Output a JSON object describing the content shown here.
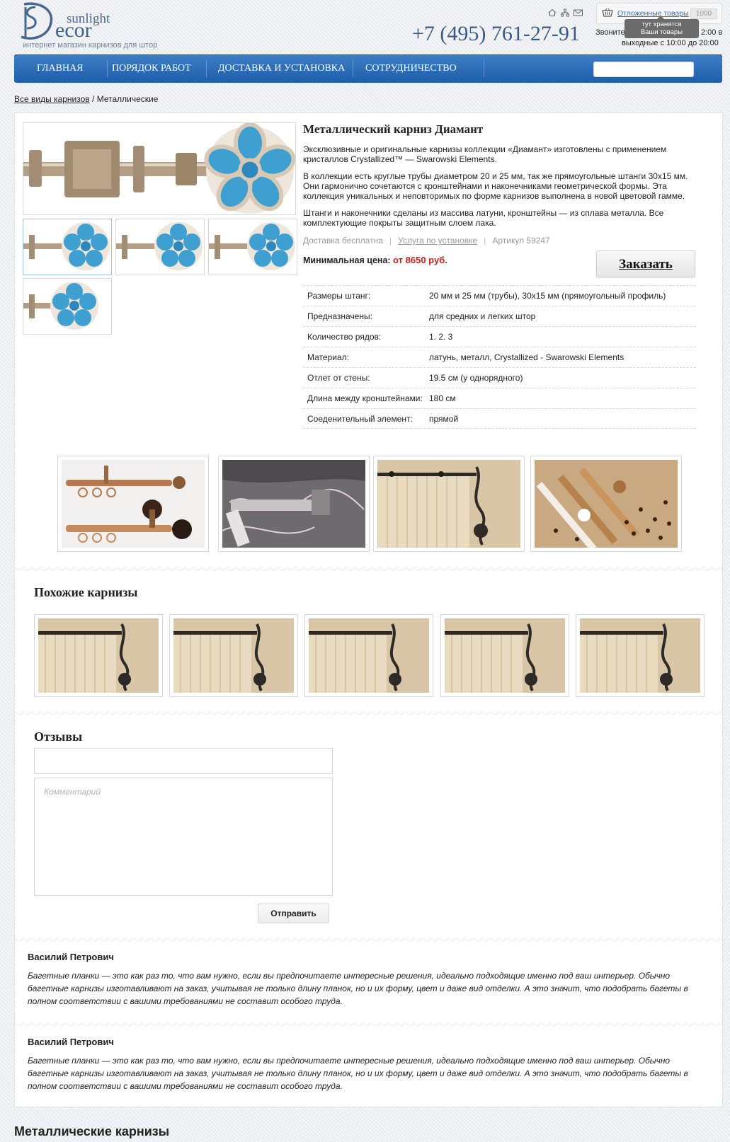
{
  "brand": {
    "logo_initials": "SD",
    "name_small": "sunlight",
    "name_large": "ecor",
    "tagline": "интернет магазин карнизов для штор",
    "accent": "#3f6188"
  },
  "header": {
    "phone": "+7 (495) 761-27-91",
    "call_text_left": "Звоните",
    "call_text_right": "2:00 в",
    "hours": "выходные с 10:00 до 20:00",
    "icons": [
      "home-icon",
      "sitemap-icon",
      "mail-icon"
    ]
  },
  "cart": {
    "link_label": "Отложенные товары",
    "count": "1000",
    "tooltip_line1": "тут хранятся",
    "tooltip_line2": "Ваши товары"
  },
  "nav": {
    "items": [
      {
        "label": "ГЛАВНАЯ"
      },
      {
        "label": "ПОРЯДОК РАБОТ"
      },
      {
        "label": "ДОСТАВКА И УСТАНОВКА"
      },
      {
        "label": "СОТРУДНИЧЕСТВО"
      }
    ],
    "search_placeholder": "",
    "color_top": "#3f7fc6",
    "color_bottom": "#1e5ea9"
  },
  "breadcrumb": {
    "link": "Все виды карнизов",
    "separator": " / ",
    "current": "Металлические"
  },
  "product": {
    "title": "Металлический карниз Диамант",
    "paragraphs": [
      "Эксклюзивные и оригинальные карнизы коллекции «Диамант» изготовлены с применением кристаллов Crystallized™ — Swarowski Elements.",
      "В коллекции есть круглые трубы диаметром 20 и 25 мм, так же прямоугольные штанги 30x15 мм. Они гармонично сочетаются с кронштейнами и наконечниками геометрической формы. Эта коллекция уникальных и неповторимых по форме карнизов выполнена в новой цветовой гамме.",
      "Штанги и наконечники сделаны из массива латуни, кронштейны — из сплава металла. Все комплектующие покрыты защитным слоем лака."
    ],
    "delivery": "Доставка бесплатна",
    "install": "Услуга по установке",
    "article": "Артикул 59247",
    "min_price_label": "Минимальная цена:",
    "min_price_value": "от 8650 руб.",
    "order_label": "Заказать",
    "price_color": "#cc1d1d",
    "specs": [
      {
        "k": "Размеры штанг:",
        "v": "20 мм и 25 мм (трубы), 30x15 мм (прямоугольный профиль)"
      },
      {
        "k": "Предназначены:",
        "v": "для средних и легких штор"
      },
      {
        "k": "Количество рядов:",
        "v": "1. 2. 3"
      },
      {
        "k": "Материал:",
        "v": "латунь, металл, Crystallized - Swarowski Elements"
      },
      {
        "k": "Отлет от стены:",
        "v": "19.5 см (у однорядного)"
      },
      {
        "k": "Длина между кронштейнами:",
        "v": "180 см"
      },
      {
        "k": "Соеденительный элемент:",
        "v": "прямой"
      }
    ]
  },
  "similar": {
    "title": "Похожие карнизы"
  },
  "reviews": {
    "title": "Отзывы",
    "name_placeholder": "",
    "comment_placeholder": "Комментарий",
    "send_label": "Отправить",
    "items": [
      {
        "author": "Василий Петрович",
        "text": "Багетные планки — это как раз то, что вам нужно, если вы предпочитаете интересные решения, идеально подходящие именно под ваш интерьер. Обычно багетные карнизы изготавливают на заказ, учитывая не только длину планок, но и их форму, цвет и даже вид отделки. А это значит, что подобрать багеты в полном соответствии с вашими требованиями не составит особого труда."
      },
      {
        "author": "Василий Петрович",
        "text": "Багетные планки — это как раз то, что вам нужно, если вы предпочитаете интересные решения, идеально подходящие именно под ваш интерьер. Обычно багетные карнизы изготавливают на заказ, учитывая не только длину планок, но и их форму, цвет и даже вид отделки. А это значит, что подобрать багеты в полном соответствии с вашими требованиями не составит особого труда."
      }
    ]
  },
  "bottom": {
    "title": "Металлические карнизы"
  }
}
